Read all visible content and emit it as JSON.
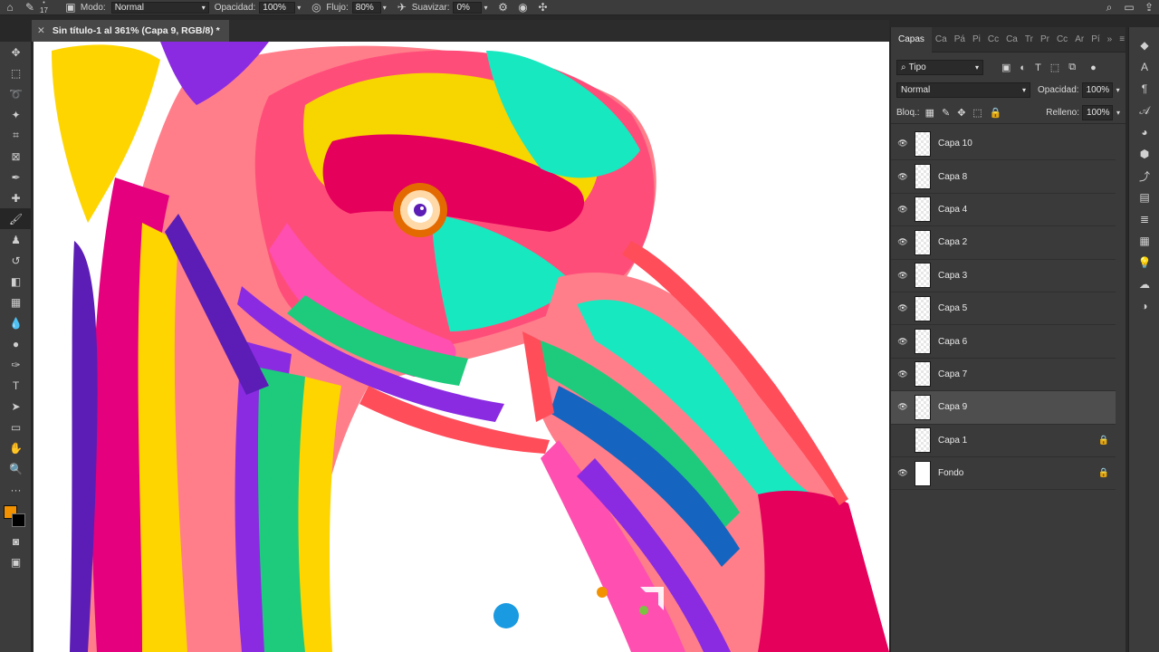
{
  "optionsbar": {
    "size_value": "17",
    "mode_label": "Modo:",
    "mode_value": "Normal",
    "opacity_label": "Opacidad:",
    "opacity_value": "100%",
    "flow_label": "Flujo:",
    "flow_value": "80%",
    "smooth_label": "Suavizar:",
    "smooth_value": "0%"
  },
  "document": {
    "tab_title": "Sin título-1 al 361% (Capa 9, RGB/8) *",
    "close_symbol": "✕"
  },
  "panel": {
    "tabs": [
      "Capas",
      "Ca",
      "Pá",
      "Pi",
      "Cc",
      "Ca",
      "Tr",
      "Pr",
      "Cc",
      "Ar",
      "Pí"
    ],
    "filter_value": "Tipo",
    "blend_value": "Normal",
    "opacity_label": "Opacidad:",
    "opacity_value": "100%",
    "lock_label": "Bloq.:",
    "fill_label": "Relleno:",
    "fill_value": "100%",
    "layers": [
      {
        "name": "Capa 10",
        "visible": true,
        "locked": false,
        "selected": false
      },
      {
        "name": "Capa 8",
        "visible": true,
        "locked": false,
        "selected": false
      },
      {
        "name": "Capa 4",
        "visible": true,
        "locked": false,
        "selected": false
      },
      {
        "name": "Capa 2",
        "visible": true,
        "locked": false,
        "selected": false
      },
      {
        "name": "Capa 3",
        "visible": true,
        "locked": false,
        "selected": false
      },
      {
        "name": "Capa 5",
        "visible": true,
        "locked": false,
        "selected": false
      },
      {
        "name": "Capa 6",
        "visible": true,
        "locked": false,
        "selected": false
      },
      {
        "name": "Capa 7",
        "visible": true,
        "locked": false,
        "selected": false
      },
      {
        "name": "Capa 9",
        "visible": true,
        "locked": false,
        "selected": true
      },
      {
        "name": "Capa 1",
        "visible": false,
        "locked": true,
        "selected": false
      },
      {
        "name": "Fondo",
        "visible": true,
        "locked": true,
        "selected": false
      }
    ]
  },
  "colors": {
    "foreground": "#f39200",
    "background": "#000000"
  }
}
